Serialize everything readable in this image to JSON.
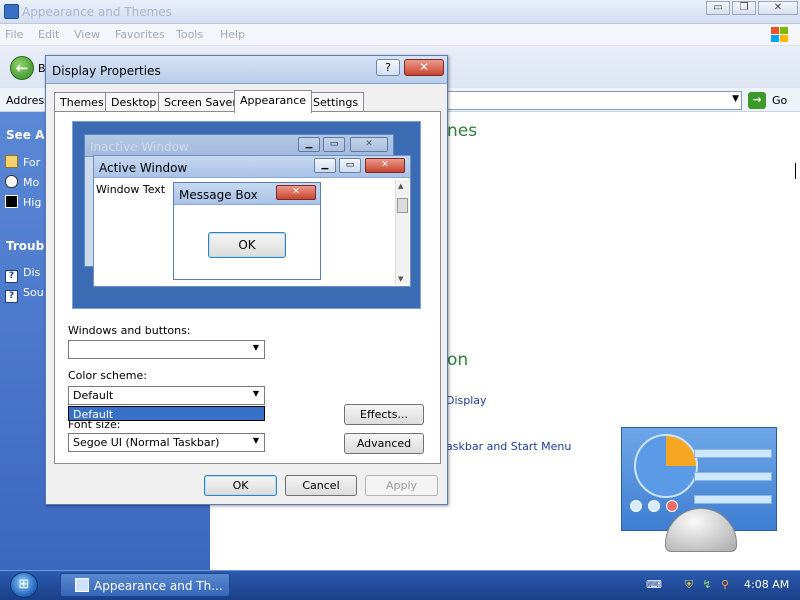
{
  "background_window": {
    "title": "Appearance and Themes",
    "controls": {
      "minimize": "▭",
      "maximize": "❐",
      "close": "✕"
    },
    "menu": [
      "File",
      "Edit",
      "View",
      "Favorites",
      "Tools",
      "Help"
    ],
    "back_label": "B",
    "address_label": "Address",
    "go_label": "Go",
    "left_pane": {
      "see_also_heading": "See Als",
      "see_also_items": [
        "For",
        "Mo",
        "Hig"
      ],
      "troubleshooters_heading": "Trouble",
      "troubleshooters_items": [
        "Dis",
        "Sou"
      ]
    },
    "main": {
      "heading_themes": "nes",
      "heading_control_panel": "on",
      "link_display": "Display",
      "link_taskbar": "askbar and Start Menu"
    }
  },
  "dialog": {
    "title": "Display Properties",
    "help_label": "?",
    "close_label": "✕",
    "tabs": [
      "Themes",
      "Desktop",
      "Screen Saver",
      "Appearance",
      "Settings"
    ],
    "active_tab": "Appearance",
    "preview": {
      "inactive_window_title": "Inactive Window",
      "active_window_title": "Active Window",
      "window_text": "Window Text",
      "message_box_title": "Message Box",
      "ok_label": "OK"
    },
    "windows_and_buttons_label": "Windows and buttons:",
    "windows_and_buttons_value": "",
    "color_scheme_label": "Color scheme:",
    "color_scheme_value": "Default",
    "color_scheme_highlighted_option": "Default",
    "font_size_label": "Font size:",
    "font_size_value": "Segoe UI (Normal Taskbar)",
    "effects_label": "Effects...",
    "advanced_label": "Advanced",
    "ok_label": "OK",
    "cancel_label": "Cancel",
    "apply_label": "Apply"
  },
  "taskbar": {
    "task_label": "Appearance and Th...",
    "clock": "4:08 AM"
  },
  "icons": {
    "start": "windows-orb-icon",
    "back": "back-arrow-icon",
    "go": "go-arrow-icon"
  },
  "colors": {
    "accent": "#3a71c8",
    "heading_green": "#2b7f3b",
    "link_blue": "#1c3e9b",
    "taskbar": "#1b3f86"
  }
}
